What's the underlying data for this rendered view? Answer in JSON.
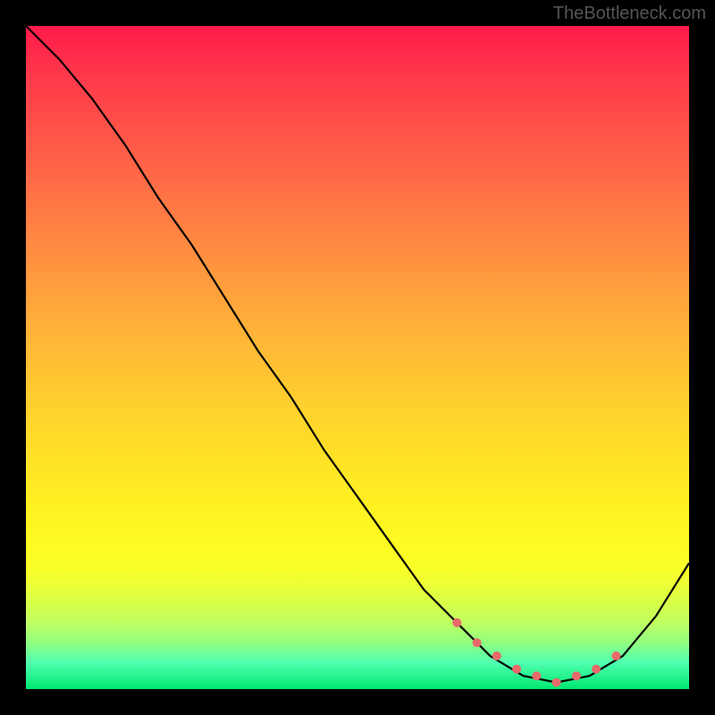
{
  "watermark": "TheBottleneck.com",
  "chart_data": {
    "type": "line",
    "title": "",
    "xlabel": "",
    "ylabel": "",
    "xlim": [
      0,
      100
    ],
    "ylim": [
      0,
      100
    ],
    "series": [
      {
        "name": "curve",
        "x": [
          0,
          5,
          10,
          15,
          20,
          25,
          30,
          35,
          40,
          45,
          50,
          55,
          60,
          65,
          70,
          75,
          80,
          85,
          90,
          95,
          100
        ],
        "values": [
          100,
          95,
          89,
          82,
          74,
          67,
          59,
          51,
          44,
          36,
          29,
          22,
          15,
          10,
          5,
          2,
          1,
          2,
          5,
          11,
          19
        ]
      }
    ],
    "highlight": {
      "name": "optimal-range",
      "x": [
        65,
        68,
        71,
        74,
        77,
        80,
        83,
        86,
        89
      ],
      "values": [
        10,
        7,
        5,
        3,
        2,
        1,
        2,
        3,
        5
      ],
      "color": "#e86a6a"
    },
    "gradient_stops": [
      {
        "pos": 0,
        "color": "#ff1a4a"
      },
      {
        "pos": 50,
        "color": "#ffd22c"
      },
      {
        "pos": 85,
        "color": "#fff820"
      },
      {
        "pos": 100,
        "color": "#00e870"
      }
    ]
  }
}
